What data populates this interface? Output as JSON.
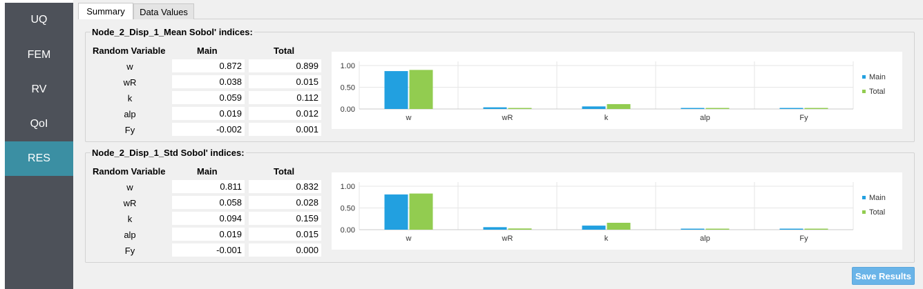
{
  "sidebar": {
    "items": [
      {
        "label": "UQ",
        "active": false
      },
      {
        "label": "FEM",
        "active": false
      },
      {
        "label": "RV",
        "active": false
      },
      {
        "label": "QoI",
        "active": false
      },
      {
        "label": "RES",
        "active": true
      }
    ],
    "active_color": "#3b8fa3",
    "background_color": "#4d5159"
  },
  "tabs": [
    {
      "label": "Summary",
      "active": true
    },
    {
      "label": "Data Values",
      "active": false
    }
  ],
  "groups": [
    {
      "title": "Node_2_Disp_1_Mean Sobol' indices:",
      "headers": {
        "rv": "Random Variable",
        "main": "Main",
        "total": "Total"
      },
      "rows": [
        {
          "name": "w",
          "main": "0.872",
          "total": "0.899"
        },
        {
          "name": "wR",
          "main": "0.038",
          "total": "0.015"
        },
        {
          "name": "k",
          "main": "0.059",
          "total": "0.112"
        },
        {
          "name": "alp",
          "main": "0.019",
          "total": "0.012"
        },
        {
          "name": "Fy",
          "main": "-0.002",
          "total": "0.001"
        }
      ]
    },
    {
      "title": "Node_2_Disp_1_Std Sobol' indices:",
      "headers": {
        "rv": "Random Variable",
        "main": "Main",
        "total": "Total"
      },
      "rows": [
        {
          "name": "w",
          "main": "0.811",
          "total": "0.832"
        },
        {
          "name": "wR",
          "main": "0.058",
          "total": "0.028"
        },
        {
          "name": "k",
          "main": "0.094",
          "total": "0.159"
        },
        {
          "name": "alp",
          "main": "0.019",
          "total": "0.015"
        },
        {
          "name": "Fy",
          "main": "-0.001",
          "total": "0.000"
        }
      ]
    }
  ],
  "chart_data": [
    {
      "type": "bar",
      "categories": [
        "w",
        "wR",
        "k",
        "alp",
        "Fy"
      ],
      "series": [
        {
          "name": "Main",
          "values": [
            0.872,
            0.038,
            0.059,
            0.019,
            -0.002
          ],
          "color": "#22a0e0"
        },
        {
          "name": "Total",
          "values": [
            0.899,
            0.015,
            0.112,
            0.012,
            0.001
          ],
          "color": "#92cc50"
        }
      ],
      "yticks": [
        "0.00",
        "0.50",
        "1.00"
      ],
      "ylim": [
        0,
        1.0
      ],
      "legend": "right",
      "grid": true
    },
    {
      "type": "bar",
      "categories": [
        "w",
        "wR",
        "k",
        "alp",
        "Fy"
      ],
      "series": [
        {
          "name": "Main",
          "values": [
            0.811,
            0.058,
            0.094,
            0.019,
            -0.001
          ],
          "color": "#22a0e0"
        },
        {
          "name": "Total",
          "values": [
            0.832,
            0.028,
            0.159,
            0.015,
            0.0
          ],
          "color": "#92cc50"
        }
      ],
      "yticks": [
        "0.00",
        "0.50",
        "1.00"
      ],
      "ylim": [
        0,
        1.0
      ],
      "legend": "right",
      "grid": true
    }
  ],
  "save_button": {
    "label": "Save Results"
  }
}
